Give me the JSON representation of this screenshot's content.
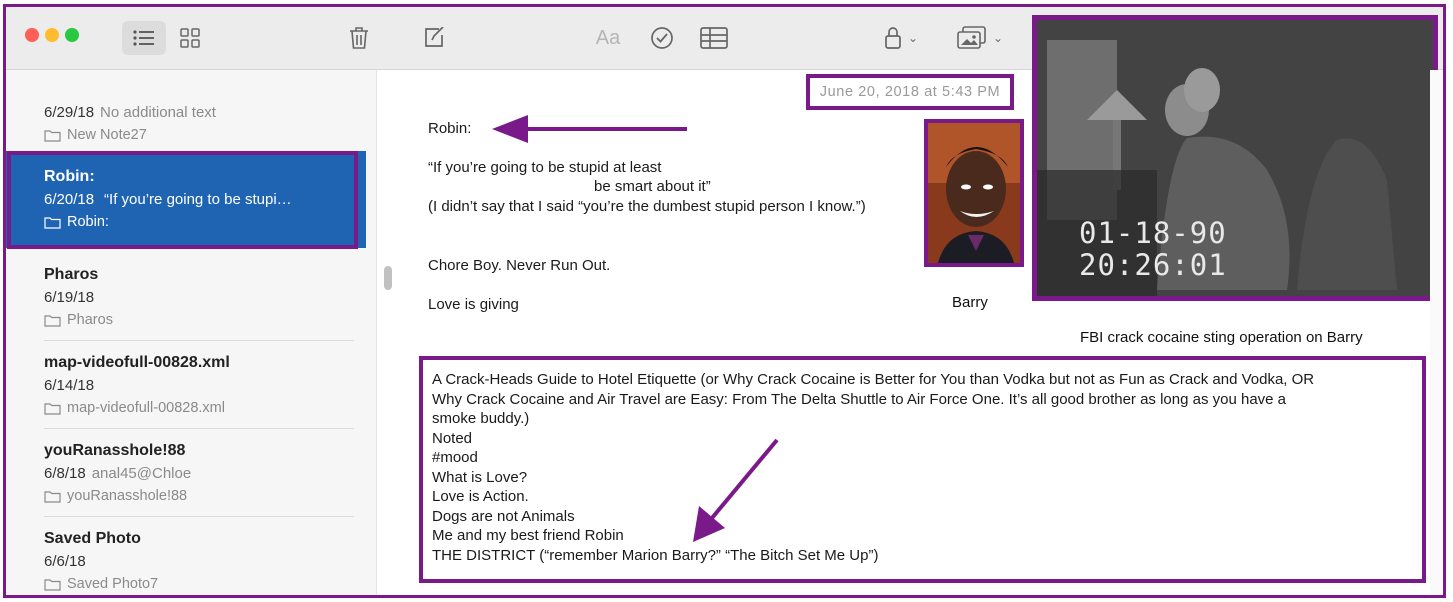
{
  "toolbar": {
    "format_label": "Aa",
    "icons": [
      "list-view-icon",
      "gallery-view-icon",
      "trash-icon",
      "compose-icon",
      "format-icon",
      "checklist-icon",
      "table-icon",
      "lock-icon",
      "media-icon"
    ]
  },
  "sidebar": {
    "notes": [
      {
        "title": "",
        "date": "6/29/18",
        "preview": "No additional text",
        "folder": "New Note27"
      },
      {
        "title": "Robin:",
        "date": "6/20/18",
        "preview": "“If you’re going to be stupi…",
        "folder": "Robin:",
        "selected": true
      },
      {
        "title": "Pharos",
        "date": "6/19/18",
        "preview": "",
        "folder": "Pharos"
      },
      {
        "title": "map-videofull-00828.xml",
        "date": "6/14/18",
        "preview": "",
        "folder": "map-videofull-00828.xml"
      },
      {
        "title": "youRanasshole!88",
        "date": "6/8/18",
        "preview": "anal45@Chloe",
        "folder": "youRanasshole!88"
      },
      {
        "title": "Saved Photo",
        "date": "6/6/18",
        "preview": "",
        "folder": "Saved Photo7"
      }
    ]
  },
  "note": {
    "timestamp": "June 20, 2018 at 5:43 PM",
    "lines": [
      "Robin:",
      "“If you’re going to be stupid at least",
      "be smart about it”",
      "(I didn’t say that I said “you’re the dumbest stupid person I know.”)",
      "Chore Boy. Never Run Out.",
      "Love is giving"
    ],
    "boxed_lines": [
      "A Crack-Heads Guide to Hotel Etiquette (or Why  Crack Cocaine is Better for You than Vodka but not as Fun as Crack and Vodka, OR",
      "Why Crack Cocaine and  Air Travel are Easy: From The Delta Shuttle to Air Force One. It’s all good brother as long as you have a",
      "smoke buddy.)",
      "Noted",
      "#mood",
      "What is Love?",
      "Love is Action.",
      "Dogs are not Animals",
      "Me and my best friend Robin",
      "THE DISTRICT (“remember Marion Barry?” “The Bitch Set Me Up”)"
    ]
  },
  "annotations": {
    "photo_caption": "Barry",
    "video_caption": "FBI crack cocaine sting operation on Barry",
    "video_date": "01-18-90",
    "video_time": "20:26:01",
    "accent_color": "#7a1a8a",
    "selection_color": "#1f63b3"
  }
}
